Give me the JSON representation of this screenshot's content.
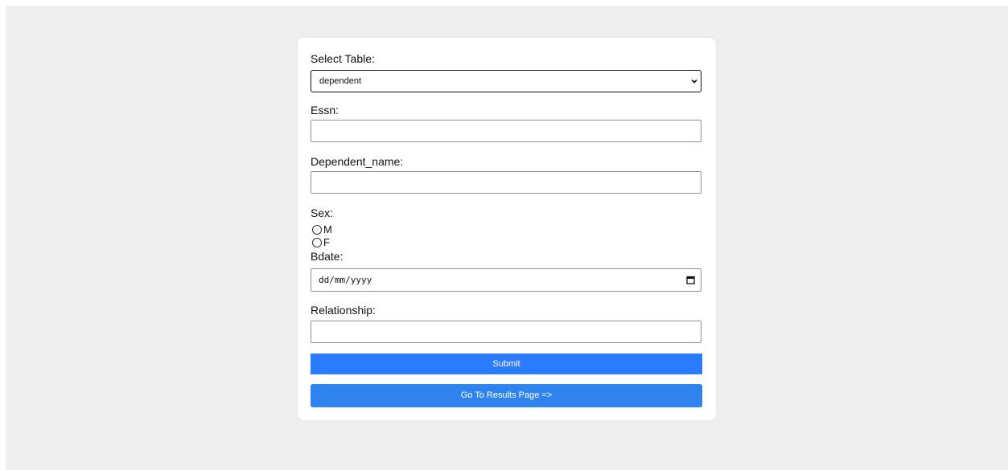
{
  "form": {
    "select_table_label": "Select Table:",
    "select_table_value": "dependent",
    "essn_label": "Essn:",
    "essn_value": "",
    "dependent_name_label": "Dependent_name:",
    "dependent_name_value": "",
    "sex_label": "Sex:",
    "sex_options": [
      "M",
      "F"
    ],
    "bdate_label": "Bdate:",
    "bdate_placeholder": "dd/mm/yyyy",
    "relationship_label": "Relationship:",
    "relationship_value": "",
    "submit_label": "Submit",
    "results_label": "Go To Results Page =>"
  },
  "icons": {
    "select_chevron": "chevron-down-icon",
    "date_picker": "calendar-icon"
  },
  "colors": {
    "page_background": "#efefef",
    "submit_button": "#2b7bfd",
    "results_button": "#2f84f0"
  }
}
